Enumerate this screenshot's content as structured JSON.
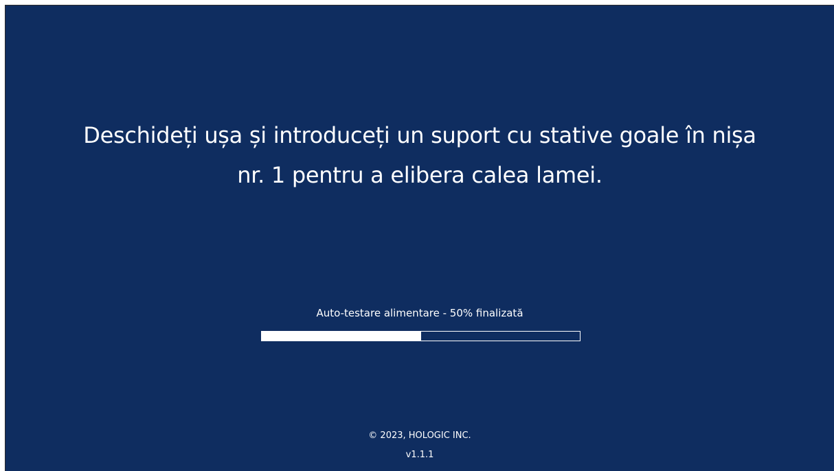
{
  "colors": {
    "background": "#0f2d60",
    "foreground": "#ffffff"
  },
  "instruction": {
    "line1": "Deschideți ușa și introduceți un suport cu stative goale în nișa",
    "line2": "nr. 1 pentru a elibera calea lamei."
  },
  "progress": {
    "label": "Auto-testare alimentare - 50% finalizată",
    "value": 0.5
  },
  "footer": {
    "copyright": "© 2023, HOLOGIC INC.",
    "version": "v1.1.1"
  }
}
